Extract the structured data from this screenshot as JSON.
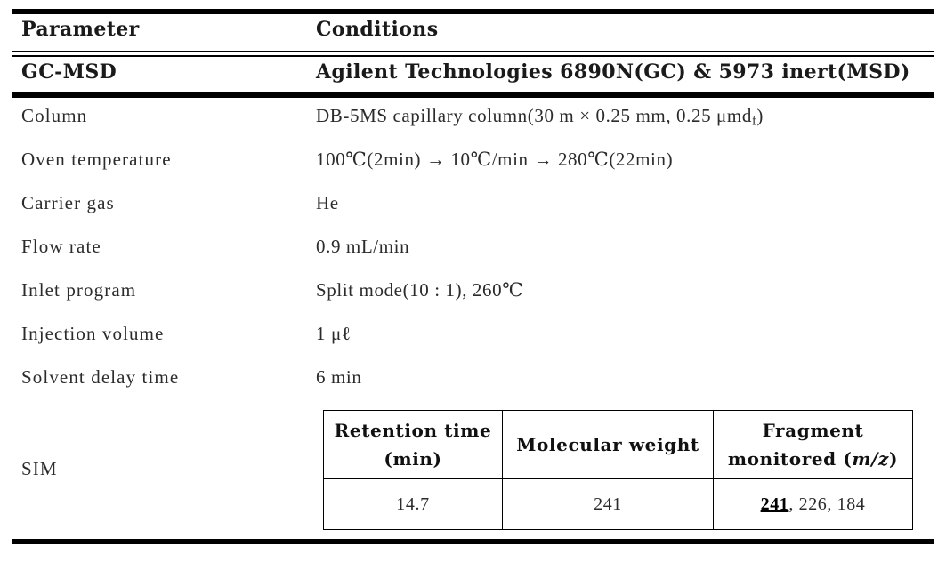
{
  "table": {
    "header": {
      "parameter": "Parameter",
      "conditions": "Conditions"
    },
    "instrument_row": {
      "parameter": "GC-MSD",
      "conditions": "Agilent Technologies 6890N(GC) & 5973 inert(MSD)"
    },
    "rows": [
      {
        "parameter": "Column",
        "value_pre": "DB-5MS capillary column(30 m × 0.25 mm, 0.25 μmd",
        "value_sub": "f",
        "value_post": ")"
      },
      {
        "parameter": "Oven temperature",
        "value": "100℃(2min) → 10℃/min → 280℃(22min)"
      },
      {
        "parameter": "Carrier gas",
        "value": "He"
      },
      {
        "parameter": "Flow rate",
        "value": "0.9 mL/min"
      },
      {
        "parameter": "Inlet program",
        "value": "Split mode(10 : 1), 260℃"
      },
      {
        "parameter": "Injection volume",
        "value": "1 μℓ"
      },
      {
        "parameter": "Solvent delay time",
        "value": "6 min"
      }
    ],
    "sim": {
      "label": "SIM",
      "columns": [
        {
          "line1": "Retention time",
          "line2": "(min)"
        },
        {
          "line1": "Molecular weight",
          "line2": ""
        },
        {
          "line1": "Fragment",
          "line2_pre": "monitored (",
          "line2_italic": "m/z",
          "line2_post": ")"
        }
      ],
      "row": {
        "retention_time": "14.7",
        "molecular_weight": "241",
        "fragment_main": "241",
        "fragment_rest": ", 226, 184"
      }
    }
  },
  "colors": {
    "rule": "#000000",
    "text": "#2b2b2b",
    "heading_text": "#111111",
    "background": "#ffffff"
  }
}
